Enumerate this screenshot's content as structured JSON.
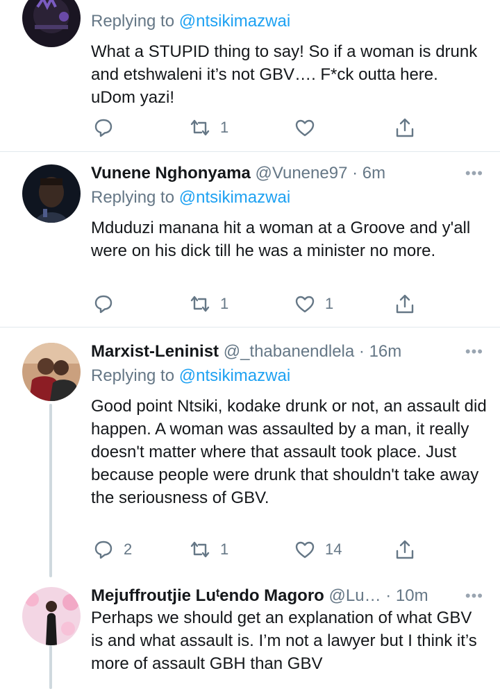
{
  "tweets": [
    {
      "name": "",
      "handle": "",
      "time": "",
      "replying_prefix": "Replying to ",
      "replying_mention": "@ntsikimazwai",
      "text": "What a STUPID thing to say! So if a woman is drunk and etshwaleni it’s not GBV…. F*ck outta here. uDom yazi!",
      "reply_count": "",
      "retweet_count": "1",
      "like_count": ""
    },
    {
      "name": "Vunene Nghonyama",
      "handle": "@Vunene97",
      "time": "· 6m",
      "replying_prefix": "Replying to ",
      "replying_mention": "@ntsikimazwai",
      "text": "Mduduzi manana hit a woman at a Groove and y'all were on his dick till he was a minister no more.",
      "reply_count": "",
      "retweet_count": "1",
      "like_count": "1"
    },
    {
      "name": "Marxist-Leninist",
      "handle": "@_thabanendlela",
      "time": "· 16m",
      "replying_prefix": "Replying to ",
      "replying_mention": "@ntsikimazwai",
      "text": "Good point Ntsiki, kodake drunk or not, an assault did happen. A woman was assaulted by a man, it really doesn't matter where that assault took place. Just because people were drunk that shouldn't take away the seriousness of GBV.",
      "reply_count": "2",
      "retweet_count": "1",
      "like_count": "14"
    },
    {
      "name": "Mejuffroutjie Luᵗendo Magoro",
      "handle": "@Lu…",
      "time": "· 10m",
      "text": "Perhaps we should get an explanation of what GBV is and what assault is. I’m not a lawyer but I think it’s more of assault GBH than GBV"
    }
  ],
  "more_glyph": "•••",
  "colors": {
    "text": "#14171a",
    "secondary": "#657786",
    "link": "#1da1f2",
    "divider": "#e1e8ed",
    "thread": "#cfd9de"
  },
  "icons": [
    "reply-icon",
    "retweet-icon",
    "like-icon",
    "share-icon",
    "more-icon"
  ]
}
